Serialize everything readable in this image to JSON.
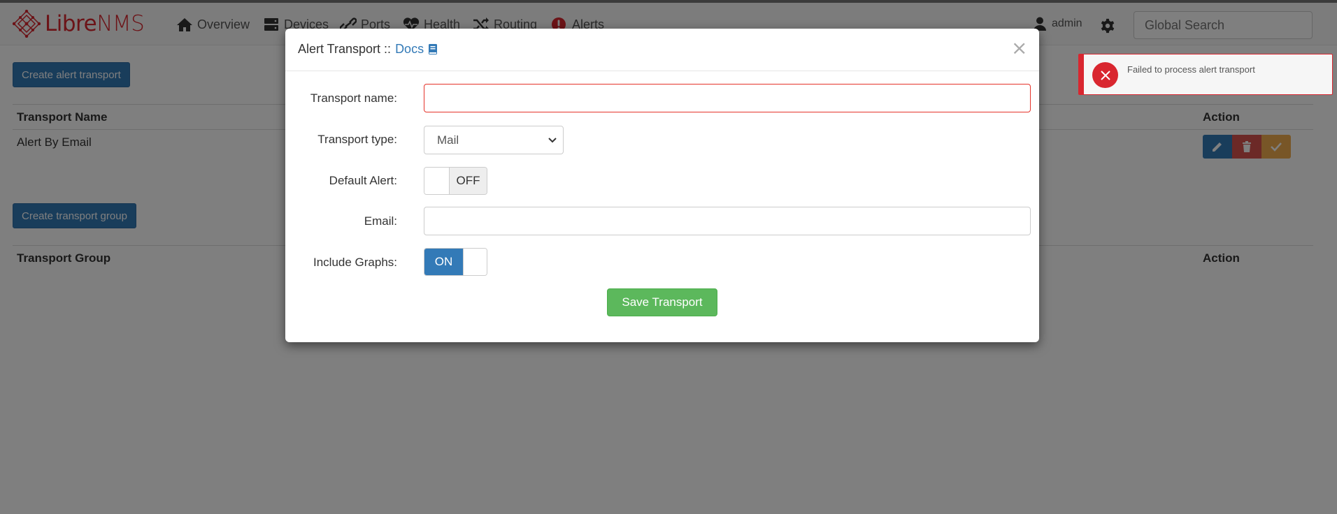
{
  "navbar": {
    "brand_libre": "Libre",
    "brand_nms": "NMS",
    "items": [
      {
        "label": "Overview",
        "icon": "home-icon"
      },
      {
        "label": "Devices",
        "icon": "server-icon"
      },
      {
        "label": "Ports",
        "icon": "link-icon"
      },
      {
        "label": "Health",
        "icon": "heartbeat-icon"
      },
      {
        "label": "Routing",
        "icon": "random-icon"
      },
      {
        "label": "Alerts",
        "icon": "exclamation-circle-icon"
      }
    ],
    "user": "admin",
    "search_placeholder": "Global Search"
  },
  "page": {
    "create_transport_button": "Create alert transport",
    "transport_table": {
      "headers": [
        "Transport Name",
        "Action"
      ],
      "rows": [
        {
          "name": "Alert By Email"
        }
      ]
    },
    "create_group_button": "Create transport group",
    "group_table": {
      "headers": [
        "Transport Group",
        "Action"
      ]
    }
  },
  "modal": {
    "title": "Alert Transport ::",
    "docs_link": "Docs",
    "close": "×",
    "fields": {
      "transport_name_label": "Transport name:",
      "transport_name_value": "",
      "transport_type_label": "Transport type:",
      "transport_type_value": "Mail",
      "default_alert_label": "Default Alert:",
      "default_alert_state": "OFF",
      "email_label": "Email:",
      "email_value": "",
      "include_graphs_label": "Include Graphs:",
      "include_graphs_state": "ON"
    },
    "save_button": "Save Transport"
  },
  "toast": {
    "message": "Failed to process alert transport",
    "type": "error"
  },
  "colors": {
    "brand_red": "#d9262f",
    "primary": "#337ab7",
    "success": "#5cb85c",
    "danger": "#d9534f",
    "warning": "#f0ad4e"
  }
}
